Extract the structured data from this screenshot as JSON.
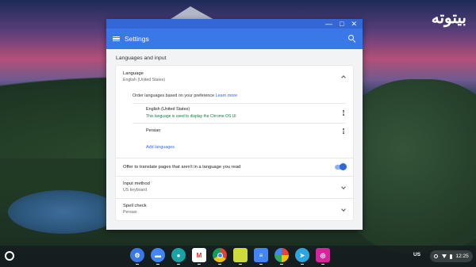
{
  "watermark": "بیتوته",
  "window": {
    "controls": {
      "minimize": "—",
      "maximize": "□",
      "close": "✕"
    },
    "appbar_title": "Settings",
    "section_title": "Languages and input",
    "language": {
      "label": "Language",
      "value": "English (United States)",
      "order_text": "Order languages based on your preference",
      "learn_more": "Learn more",
      "languages": [
        {
          "name": "English (United States)",
          "note": "This language is used to display the Chrome OS UI"
        },
        {
          "name": "Persian",
          "note": ""
        }
      ],
      "add_languages": "Add languages"
    },
    "translate_offer": {
      "label": "Offer to translate pages that aren't in a language you read",
      "enabled": true
    },
    "input_method": {
      "label": "Input method",
      "value": "US keyboard"
    },
    "spell_check": {
      "label": "Spell check",
      "value": "Persian"
    }
  },
  "shelf": {
    "apps": [
      {
        "name": "settings-app-icon",
        "color": "#3b78e7"
      },
      {
        "name": "files-app-icon",
        "color": "#4285f4"
      },
      {
        "name": "drop-app-icon",
        "color": "#1aa3a3"
      },
      {
        "name": "gmail-app-icon",
        "color": "#ffffff"
      },
      {
        "name": "chrome-app-icon",
        "color": "#ffffff"
      },
      {
        "name": "keep-app-icon",
        "color": "#cddc39"
      },
      {
        "name": "docs-app-icon",
        "color": "#4285f4"
      },
      {
        "name": "pinwheel-app-icon",
        "color": "#ffffff"
      },
      {
        "name": "telegram-app-icon",
        "color": "#2ca5e0"
      },
      {
        "name": "instagram-app-icon",
        "color": "#d6249f"
      }
    ],
    "ime": "US",
    "time": "12:25"
  }
}
